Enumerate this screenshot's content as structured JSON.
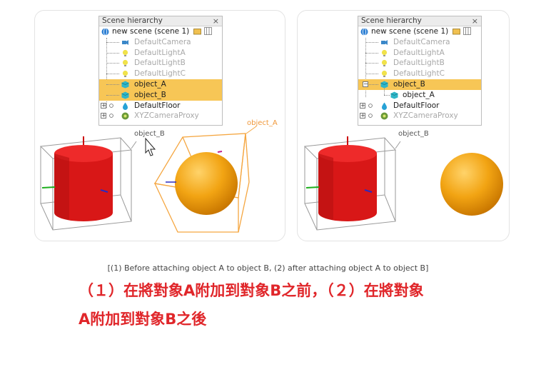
{
  "panel1": {
    "hierarchy": {
      "title": "Scene hierarchy",
      "close": "×",
      "rows": [
        {
          "label": "new scene (scene 1)"
        },
        {
          "label": "DefaultCamera"
        },
        {
          "label": "DefaultLightA"
        },
        {
          "label": "DefaultLightB"
        },
        {
          "label": "DefaultLightC"
        },
        {
          "label": "object_A"
        },
        {
          "label": "object_B"
        },
        {
          "label": "DefaultFloor"
        },
        {
          "label": "XYZCameraProxy"
        }
      ]
    },
    "scene_label_b": "object_B",
    "scene_label_a": "object_A"
  },
  "panel2": {
    "hierarchy": {
      "title": "Scene hierarchy",
      "close": "×",
      "rows": [
        {
          "label": "new scene (scene 1)"
        },
        {
          "label": "DefaultCamera"
        },
        {
          "label": "DefaultLightA"
        },
        {
          "label": "DefaultLightB"
        },
        {
          "label": "DefaultLightC"
        },
        {
          "label": "object_B"
        },
        {
          "label": "object_A"
        },
        {
          "label": "DefaultFloor"
        },
        {
          "label": "XYZCameraProxy"
        }
      ]
    },
    "scene_label_b": "object_B"
  },
  "caption": "[(1) Before attaching object A to object B, (2) after attaching object A to object B]",
  "chinese_line1": "（１）在將對象A附加到對象B之前，（２）在將對象",
  "chinese_line2": "A附加到對象B之後",
  "colors": {
    "selection": "#f7c656",
    "cylinder": "#e01b1b",
    "sphere": "#f0a010",
    "caption_red": "#e0262a",
    "bounding_box_orange": "#f5a640"
  }
}
